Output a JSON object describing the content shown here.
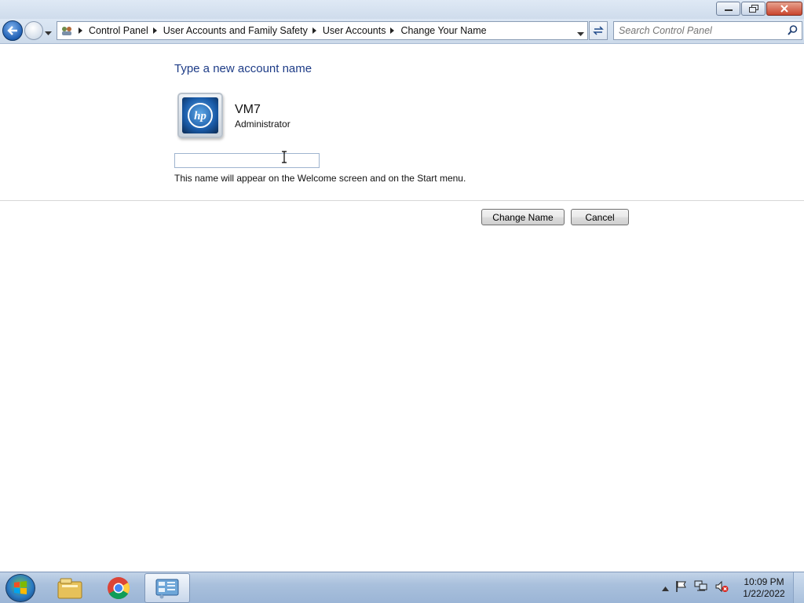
{
  "window": {
    "minimize_label": "",
    "colors": {
      "titlebar": "#cfdcec",
      "close": "#c9452e",
      "heading": "#1e3c87"
    }
  },
  "address_bar": {
    "breadcrumbs": [
      "Control Panel",
      "User Accounts and Family Safety",
      "User Accounts",
      "Change Your Name"
    ]
  },
  "search": {
    "placeholder": "Search Control Panel"
  },
  "content": {
    "heading": "Type a new account name",
    "user": {
      "name": "VM7",
      "role": "Administrator"
    },
    "name_field": {
      "value": "",
      "placeholder": ""
    },
    "hint": "This name will appear on the Welcome screen and on the Start menu."
  },
  "buttons": {
    "change_name": "Change Name",
    "cancel": "Cancel"
  },
  "taskbar": {
    "items": [
      "file-explorer-icon",
      "chrome-icon",
      "control-panel-icon"
    ],
    "clock": {
      "time": "10:09 PM",
      "date": "1/22/2022"
    }
  }
}
